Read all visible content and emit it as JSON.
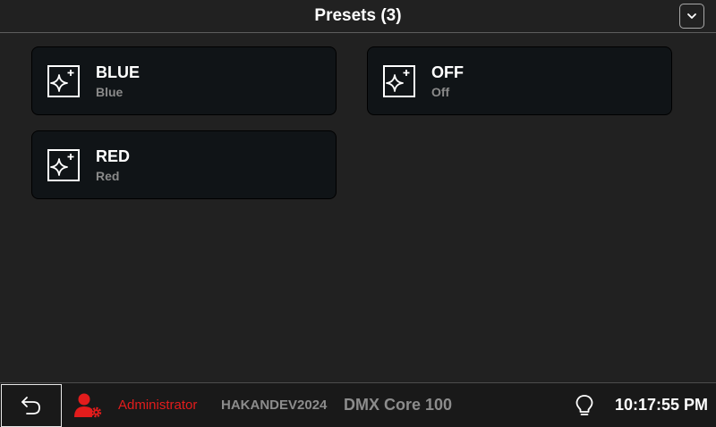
{
  "header": {
    "title": "Presets (3)",
    "collapse_icon": "chevron-down-icon"
  },
  "presets": [
    {
      "name": "BLUE",
      "subtitle": "Blue",
      "icon": "sparkle-icon"
    },
    {
      "name": "OFF",
      "subtitle": "Off",
      "icon": "sparkle-icon"
    },
    {
      "name": "RED",
      "subtitle": "Red",
      "icon": "sparkle-icon"
    }
  ],
  "footer": {
    "back_icon": "undo-arrow-icon",
    "user_icon": "admin-user-gear-icon",
    "user_role": "Administrator",
    "device_id": "HAKANDEV2024",
    "device_model": "DMX Core 100",
    "light_icon": "lightbulb-icon",
    "time": "10:17:55 PM"
  },
  "colors": {
    "background": "#212121",
    "card": "#101417",
    "admin_red": "#e31c1c",
    "muted_text": "#8c8c8c"
  }
}
